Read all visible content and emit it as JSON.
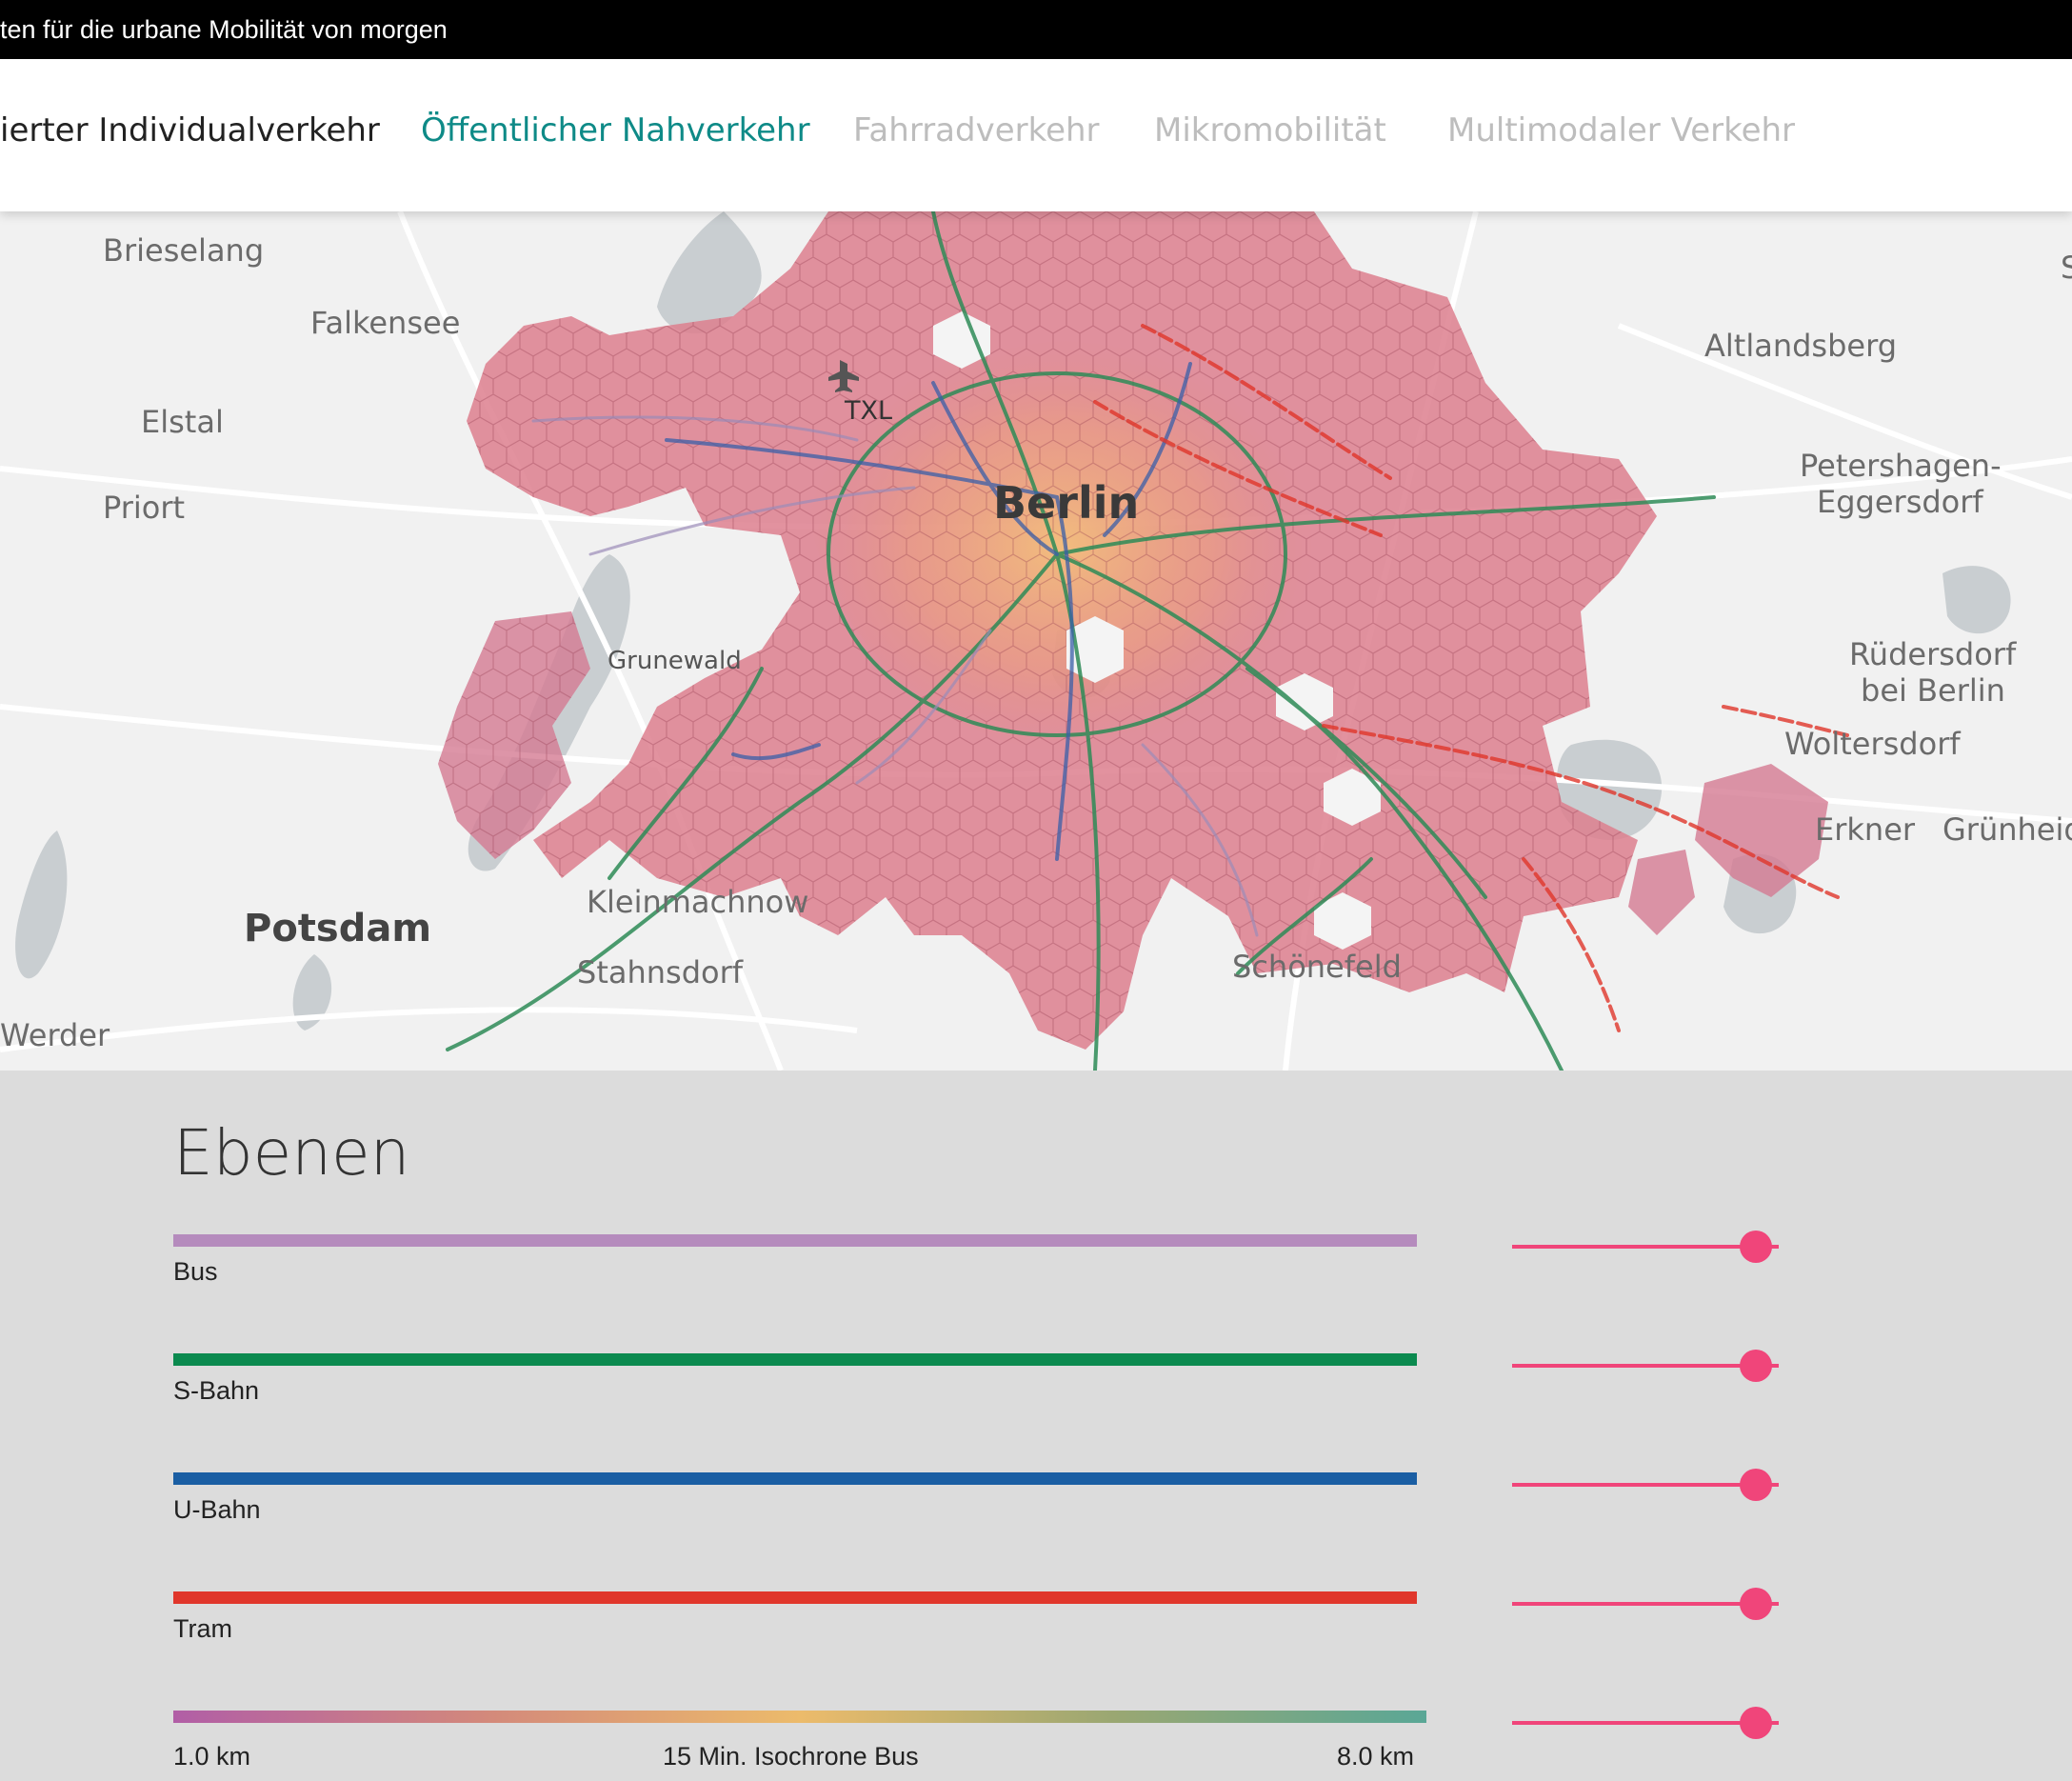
{
  "header": {
    "tagline": "ten für die urbane Mobilität von morgen"
  },
  "tabs": [
    {
      "label": "ierter Individualverkehr",
      "state": "default"
    },
    {
      "label": "Öffentlicher Nahverkehr",
      "state": "active"
    },
    {
      "label": "Fahrradverkehr",
      "state": "inactive"
    },
    {
      "label": "Mikromobilität",
      "state": "inactive"
    },
    {
      "label": "Multimodaler Verkehr",
      "state": "inactive"
    }
  ],
  "map": {
    "airport_label": "TXL",
    "places": [
      "Brieselang",
      "Falkensee",
      "Elstal",
      "Priort",
      "Berlin",
      "Grunewald",
      "Altlandsberg",
      "Petershagen-",
      "Eggersdorf",
      "Rüdersdorf",
      "bei Berlin",
      "Woltersdorf",
      "Erkner",
      "Grünheid",
      "Kleinmachnow",
      "Stahnsdorf",
      "Potsdam",
      "Werder",
      "Schönefeld",
      "S"
    ]
  },
  "panel": {
    "title": "Ebenen",
    "layers": [
      {
        "name": "Bus",
        "color": "#b58bbd",
        "slider_value": 1
      },
      {
        "name": "S-Bahn",
        "color": "#0b8a4f",
        "slider_value": 1
      },
      {
        "name": "U-Bahn",
        "color": "#1a5ea3",
        "slider_value": 1
      },
      {
        "name": "Tram",
        "color": "#e0362b",
        "slider_value": 1
      }
    ],
    "isochrone": {
      "min_label": "1.0 km",
      "name": "15 Min. Isochrone Bus",
      "max_label": "8.0 km",
      "gradient": [
        "#b15ea6",
        "#d3897b",
        "#ecbb6b",
        "#9aa772",
        "#5aa796"
      ],
      "slider_value": 1
    },
    "slider_color": "#f0457a"
  }
}
